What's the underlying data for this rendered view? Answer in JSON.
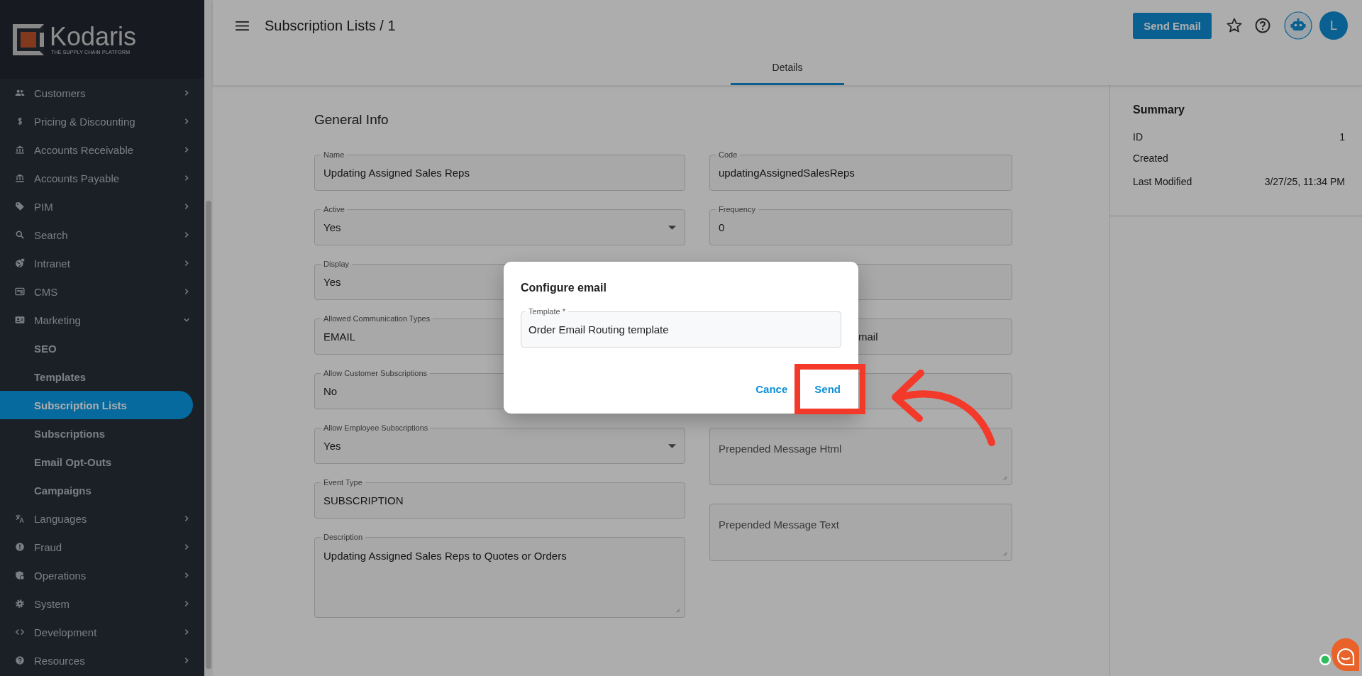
{
  "sidebar": {
    "logo": {
      "name": "Kodaris",
      "tagline": "THE SUPPLY CHAIN PLATFORM"
    },
    "items": [
      {
        "label": "Customers",
        "expanded": false
      },
      {
        "label": "Pricing & Discounting",
        "expanded": false
      },
      {
        "label": "Accounts Receivable",
        "expanded": false
      },
      {
        "label": "Accounts Payable",
        "expanded": false
      },
      {
        "label": "PIM",
        "expanded": false
      },
      {
        "label": "Search",
        "expanded": false
      },
      {
        "label": "Intranet",
        "expanded": false
      },
      {
        "label": "CMS",
        "expanded": false
      },
      {
        "label": "Marketing",
        "expanded": true,
        "children": [
          {
            "label": "SEO",
            "selected": false
          },
          {
            "label": "Templates",
            "selected": false
          },
          {
            "label": "Subscription Lists",
            "selected": true
          },
          {
            "label": "Subscriptions",
            "selected": false
          },
          {
            "label": "Email Opt-Outs",
            "selected": false
          },
          {
            "label": "Campaigns",
            "selected": false
          }
        ]
      },
      {
        "label": "Languages",
        "expanded": false
      },
      {
        "label": "Fraud",
        "expanded": false
      },
      {
        "label": "Operations",
        "expanded": false
      },
      {
        "label": "System",
        "expanded": false
      },
      {
        "label": "Development",
        "expanded": false
      },
      {
        "label": "Resources",
        "expanded": false
      }
    ]
  },
  "header": {
    "title": "Subscription Lists / 1",
    "send_email": "Send Email",
    "avatar": "L"
  },
  "tabs": [
    {
      "label": "Details",
      "selected": true
    }
  ],
  "form": {
    "title": "General Info",
    "left": [
      {
        "kind": "text",
        "label": "Name",
        "value": "Updating Assigned Sales Reps"
      },
      {
        "kind": "select",
        "label": "Active",
        "value": "Yes"
      },
      {
        "kind": "text",
        "label": "Display",
        "value": "Yes"
      },
      {
        "kind": "text",
        "label": "Allowed Communication Types",
        "value": "EMAIL"
      },
      {
        "kind": "text",
        "label": "Allow Customer Subscriptions",
        "value": "No"
      },
      {
        "kind": "select",
        "label": "Allow Employee Subscriptions",
        "value": "Yes"
      },
      {
        "kind": "text",
        "label": "Event Type",
        "value": "SUBSCRIPTION"
      },
      {
        "kind": "textarea",
        "label": "Description",
        "value": "Updating Assigned Sales Reps to Quotes or Orders"
      }
    ],
    "right": [
      {
        "kind": "text",
        "label": "Code",
        "value": "updatingAssignedSalesReps"
      },
      {
        "kind": "text",
        "label": "Frequency",
        "value": "0"
      },
      {
        "kind": "text"
      },
      {
        "kind": "text",
        "value": "mail",
        "clipped": true
      },
      {
        "kind": "text"
      },
      {
        "kind": "textarea",
        "placeholder": "Prepended Message Html"
      },
      {
        "kind": "textarea",
        "placeholder": "Prepended Message Text"
      }
    ]
  },
  "summary": {
    "title": "Summary",
    "rows": [
      {
        "label": "ID",
        "value": "1"
      },
      {
        "label": "Created"
      },
      {
        "label": "Last Modified",
        "value": "3/27/25, 11:34 PM"
      }
    ]
  },
  "dialog": {
    "title": "Configure email",
    "template": {
      "label": "Template *",
      "value": "Order Email Routing template"
    },
    "buttons": [
      "Cance",
      "Send"
    ]
  }
}
